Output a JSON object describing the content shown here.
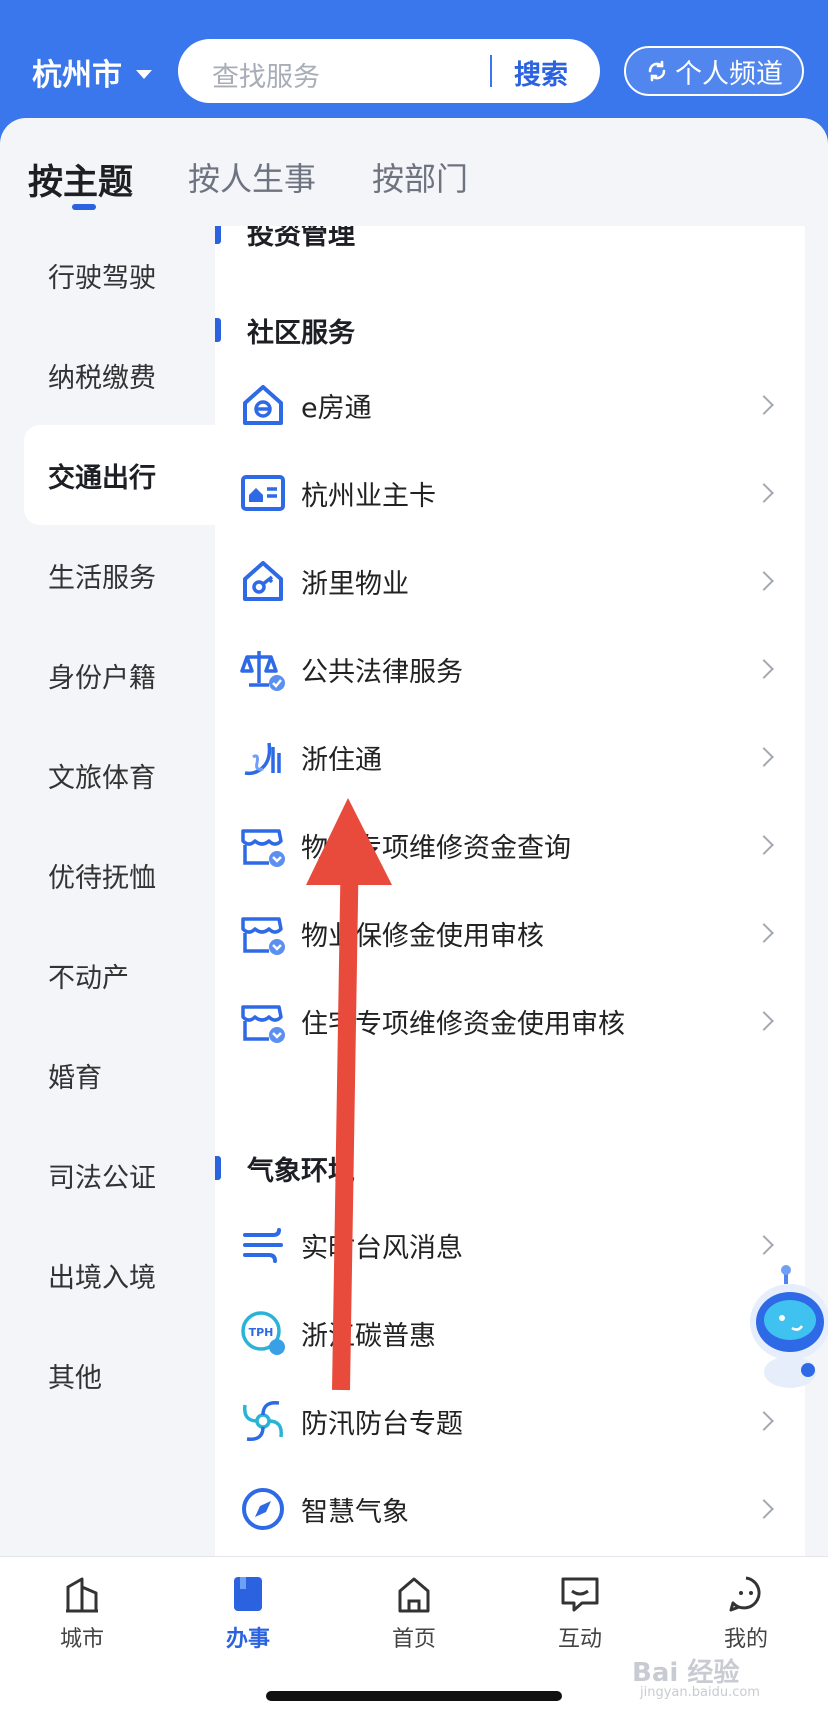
{
  "header": {
    "city": "杭州市",
    "search_placeholder": "查找服务",
    "search_button": "搜索",
    "personal_channel": "个人频道"
  },
  "tabs": [
    {
      "label": "按主题",
      "active": true
    },
    {
      "label": "按人生事",
      "active": false
    },
    {
      "label": "按部门",
      "active": false
    }
  ],
  "left_nav": [
    {
      "label": "行驶驾驶"
    },
    {
      "label": "纳税缴费"
    },
    {
      "label": "交通出行",
      "active": true
    },
    {
      "label": "生活服务"
    },
    {
      "label": "身份户籍"
    },
    {
      "label": "文旅体育"
    },
    {
      "label": "优待抚恤"
    },
    {
      "label": "不动产"
    },
    {
      "label": "婚育"
    },
    {
      "label": "司法公证"
    },
    {
      "label": "出境入境"
    },
    {
      "label": "其他"
    }
  ],
  "sections": [
    {
      "title": "投资管理",
      "items": []
    },
    {
      "title": "社区服务",
      "items": [
        {
          "label": "e房通",
          "icon": "e-house-icon"
        },
        {
          "label": "杭州业主卡",
          "icon": "owner-card-icon"
        },
        {
          "label": "浙里物业",
          "icon": "property-key-icon"
        },
        {
          "label": "公共法律服务",
          "icon": "scales-icon"
        },
        {
          "label": "浙住通",
          "icon": "zhezhutong-icon"
        },
        {
          "label": "物业专项维修资金查询",
          "icon": "shop-shield-icon"
        },
        {
          "label": "物业保修金使用审核",
          "icon": "shop-shield-icon"
        },
        {
          "label": "住宅专项维修资金使用审核",
          "icon": "shop-shield-icon"
        }
      ]
    },
    {
      "title": "气象环境",
      "items": [
        {
          "label": "实时台风消息",
          "icon": "wind-icon"
        },
        {
          "label": "浙江碳普惠",
          "icon": "tph-icon"
        },
        {
          "label": "防汛防台专题",
          "icon": "typhoon-swirl-icon"
        },
        {
          "label": "智慧气象",
          "icon": "compass-icon"
        }
      ]
    }
  ],
  "bottom_nav": [
    {
      "label": "城市",
      "icon": "city-building-icon"
    },
    {
      "label": "办事",
      "icon": "book-icon",
      "active": true
    },
    {
      "label": "首页",
      "icon": "home-icon"
    },
    {
      "label": "互动",
      "icon": "chat-icon"
    },
    {
      "label": "我的",
      "icon": "profile-face-icon"
    }
  ],
  "watermark": {
    "text": "Bai 经验",
    "sub": "jingyan.baidu.com"
  },
  "colors": {
    "primary": "#3a76ec",
    "accent": "#2a62e0",
    "arrow": "#e84b3c"
  }
}
